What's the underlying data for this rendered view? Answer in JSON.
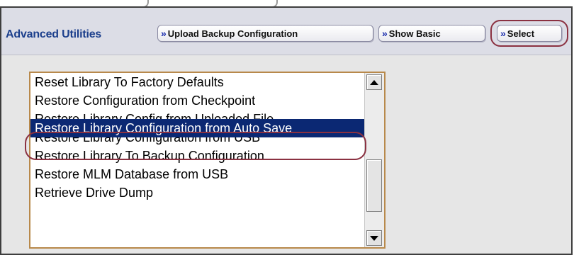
{
  "toolbar": {
    "title": "Advanced Utilities",
    "buttons": [
      {
        "label": "Upload Backup Configuration",
        "icon": "double-chevron-right-icon"
      },
      {
        "label": "Show Basic",
        "icon": "double-chevron-right-icon"
      },
      {
        "label": "Select",
        "icon": "double-chevron-right-icon"
      }
    ],
    "chevron_glyph": "»"
  },
  "utilities_list": {
    "items": [
      "Reset Library To Factory Defaults",
      "Restore Configuration from Checkpoint",
      "Restore Library Config from Uploaded File",
      "Restore Library Configuration from Auto Save",
      "Restore Library Configuration from USB",
      "Restore Library To Backup Configuration",
      "Restore MLM Database from USB",
      "Retrieve Drive Dump"
    ],
    "selected_index": 3
  },
  "colors": {
    "title_blue": "#1c3f8c",
    "selection_bg": "#0b2873",
    "callout_ring": "#8b3141",
    "listbox_border": "#b8894b"
  }
}
